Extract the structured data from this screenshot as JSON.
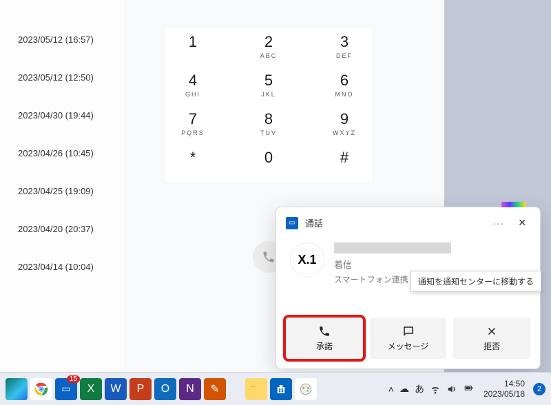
{
  "call_history": [
    "2023/05/12 (16:57)",
    "2023/05/12 (12:50)",
    "2023/04/30 (19:44)",
    "2023/04/26 (10:45)",
    "2023/04/25 (19:09)",
    "2023/04/20 (20:37)",
    "2023/04/14 (10:04)"
  ],
  "dialpad": [
    {
      "digit": "1",
      "letters": ""
    },
    {
      "digit": "2",
      "letters": "ABC"
    },
    {
      "digit": "3",
      "letters": "DEF"
    },
    {
      "digit": "4",
      "letters": "GHI"
    },
    {
      "digit": "5",
      "letters": "JKL"
    },
    {
      "digit": "6",
      "letters": "MNO"
    },
    {
      "digit": "7",
      "letters": "PQRS"
    },
    {
      "digit": "8",
      "letters": "TUV"
    },
    {
      "digit": "9",
      "letters": "WXYZ"
    },
    {
      "digit": "*",
      "letters": ""
    },
    {
      "digit": "0",
      "letters": ""
    },
    {
      "digit": "#",
      "letters": ""
    }
  ],
  "toast": {
    "app_title": "通話",
    "avatar_text": "X.1",
    "status": "着信",
    "via": "スマートフォン連携 経由",
    "tooltip": "通知を通知センターに移動する",
    "actions": {
      "accept": "承諾",
      "message": "メッセージ",
      "decline": "拒否"
    }
  },
  "taskbar": {
    "phone_link_badge": "15",
    "ime": "あ",
    "time": "14:50",
    "date": "2023/05/18",
    "notif_count": "2"
  }
}
